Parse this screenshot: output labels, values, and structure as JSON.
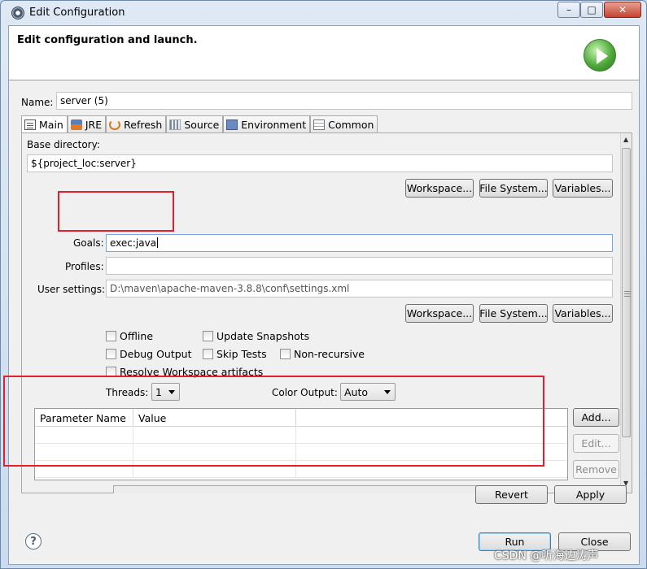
{
  "window": {
    "title": "Edit Configuration",
    "minimize_label": "–",
    "maximize_label": "□",
    "close_label": "✕"
  },
  "banner": {
    "title": "Edit configuration and launch.",
    "icon": "run-launch-icon"
  },
  "name": {
    "label": "Name:",
    "value": "server (5)"
  },
  "tabs": [
    {
      "label": "Main",
      "icon": "main-tab-icon",
      "active": true
    },
    {
      "label": "JRE",
      "icon": "jre-icon"
    },
    {
      "label": "Refresh",
      "icon": "refresh-icon"
    },
    {
      "label": "Source",
      "icon": "source-icon"
    },
    {
      "label": "Environment",
      "icon": "environment-icon"
    },
    {
      "label": "Common",
      "icon": "common-icon"
    }
  ],
  "main": {
    "base_directory": {
      "label": "Base directory:",
      "value": "${project_loc:server}"
    },
    "base_buttons": {
      "workspace": "Workspace...",
      "file_system": "File System...",
      "variables": "Variables..."
    },
    "goals": {
      "label": "Goals:",
      "value": "exec:java"
    },
    "profiles": {
      "label": "Profiles:",
      "value": ""
    },
    "user_settings": {
      "label": "User settings:",
      "value": "D:\\maven\\apache-maven-3.8.8\\conf\\settings.xml"
    },
    "settings_buttons": {
      "workspace": "Workspace...",
      "file_system": "File System...",
      "variables": "Variables..."
    },
    "checkboxes": {
      "offline": "Offline",
      "update_snapshots": "Update Snapshots",
      "debug_output": "Debug Output",
      "skip_tests": "Skip Tests",
      "non_recursive": "Non-recursive",
      "resolve_workspace": "Resolve Workspace artifacts"
    },
    "threads": {
      "label": "Threads:",
      "value": "1"
    },
    "color_output": {
      "label": "Color Output:",
      "value": "Auto"
    },
    "parameters": {
      "columns": [
        "Parameter Name",
        "Value",
        ""
      ],
      "rows": [
        [
          "",
          "",
          ""
        ],
        [
          "",
          "",
          ""
        ],
        [
          "",
          "",
          ""
        ]
      ],
      "add": "Add...",
      "edit": "Edit...",
      "remove": "Remove"
    }
  },
  "footer": {
    "revert": "Revert",
    "apply": "Apply",
    "run": "Run",
    "close": "Close",
    "help_icon": "help-icon"
  },
  "watermark": "CSDN @听海边涛声",
  "colors": {
    "annotation_red": "#e0202a",
    "window_chrome": "#c9d9ec"
  }
}
